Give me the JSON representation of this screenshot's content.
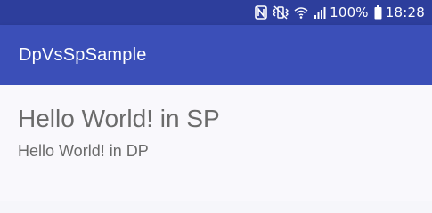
{
  "status_bar": {
    "icons": [
      "nfc-icon",
      "vibrate-mute-icon",
      "wifi-icon",
      "signal-icon",
      "battery-icon"
    ],
    "battery_text": "100%",
    "time": "18:28"
  },
  "app_bar": {
    "title": "DpVsSpSample"
  },
  "main": {
    "text_sp": "Hello World! in SP",
    "text_dp": "Hello World! in DP"
  },
  "colors": {
    "status_bar_bg": "#2d3e9c",
    "app_bar_bg": "#3b4fb8",
    "content_bg": "#f9f8fc",
    "text_color": "#6b6b6b"
  }
}
